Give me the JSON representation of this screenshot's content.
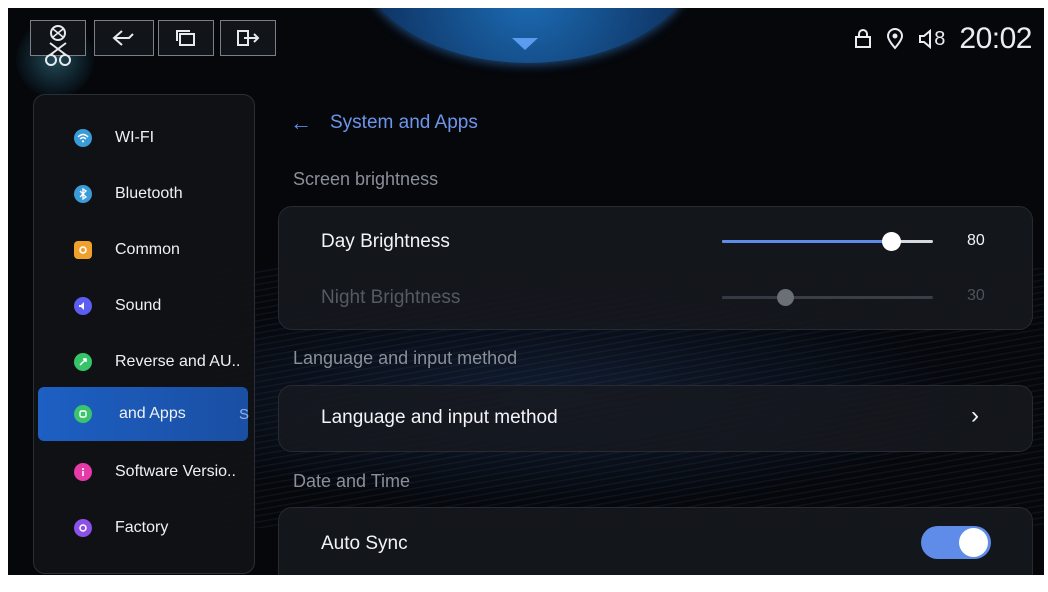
{
  "status_bar": {
    "time": "20:02",
    "icons": [
      "lock-icon",
      "location-icon",
      "volume-icon"
    ],
    "volume_level": "8"
  },
  "top_buttons": [
    "logo-icon",
    "back-gesture-icon",
    "windows-icon",
    "exit-icon"
  ],
  "sidebar": {
    "items": [
      {
        "label": "WI-FI",
        "icon": "wifi-icon",
        "color": "#3a9bd9"
      },
      {
        "label": "Bluetooth",
        "icon": "bluetooth-icon",
        "color": "#3a9bd9"
      },
      {
        "label": "Common",
        "icon": "common-icon",
        "color": "#f0a12b"
      },
      {
        "label": "Sound",
        "icon": "sound-icon",
        "color": "#5b5ef0"
      },
      {
        "label": "Reverse and AU..",
        "icon": "reverse-icon",
        "color": "#37c36a"
      },
      {
        "label": "and Apps",
        "trail": "S",
        "icon": "apps-icon",
        "color": "#39c46d",
        "active": true
      },
      {
        "label": "Software Versio..",
        "icon": "info-icon",
        "color": "#e53aa8"
      },
      {
        "label": "Factory",
        "icon": "factory-icon",
        "color": "#8a52e8"
      }
    ]
  },
  "page": {
    "title": "System and Apps",
    "sections": {
      "brightness": "Screen brightness",
      "language": "Language and input method",
      "datetime": "Date and Time"
    },
    "day_brightness": {
      "label": "Day Brightness",
      "value": "80",
      "fraction": 0.8
    },
    "night_brightness": {
      "label": "Night Brightness",
      "value": "30",
      "fraction": 0.3
    },
    "language_row": {
      "label": "Language and input method"
    },
    "auto_sync": {
      "label": "Auto Sync",
      "on": true
    }
  },
  "colors": {
    "accent": "#5f8ce8",
    "active_item": "#1d5fc3"
  }
}
